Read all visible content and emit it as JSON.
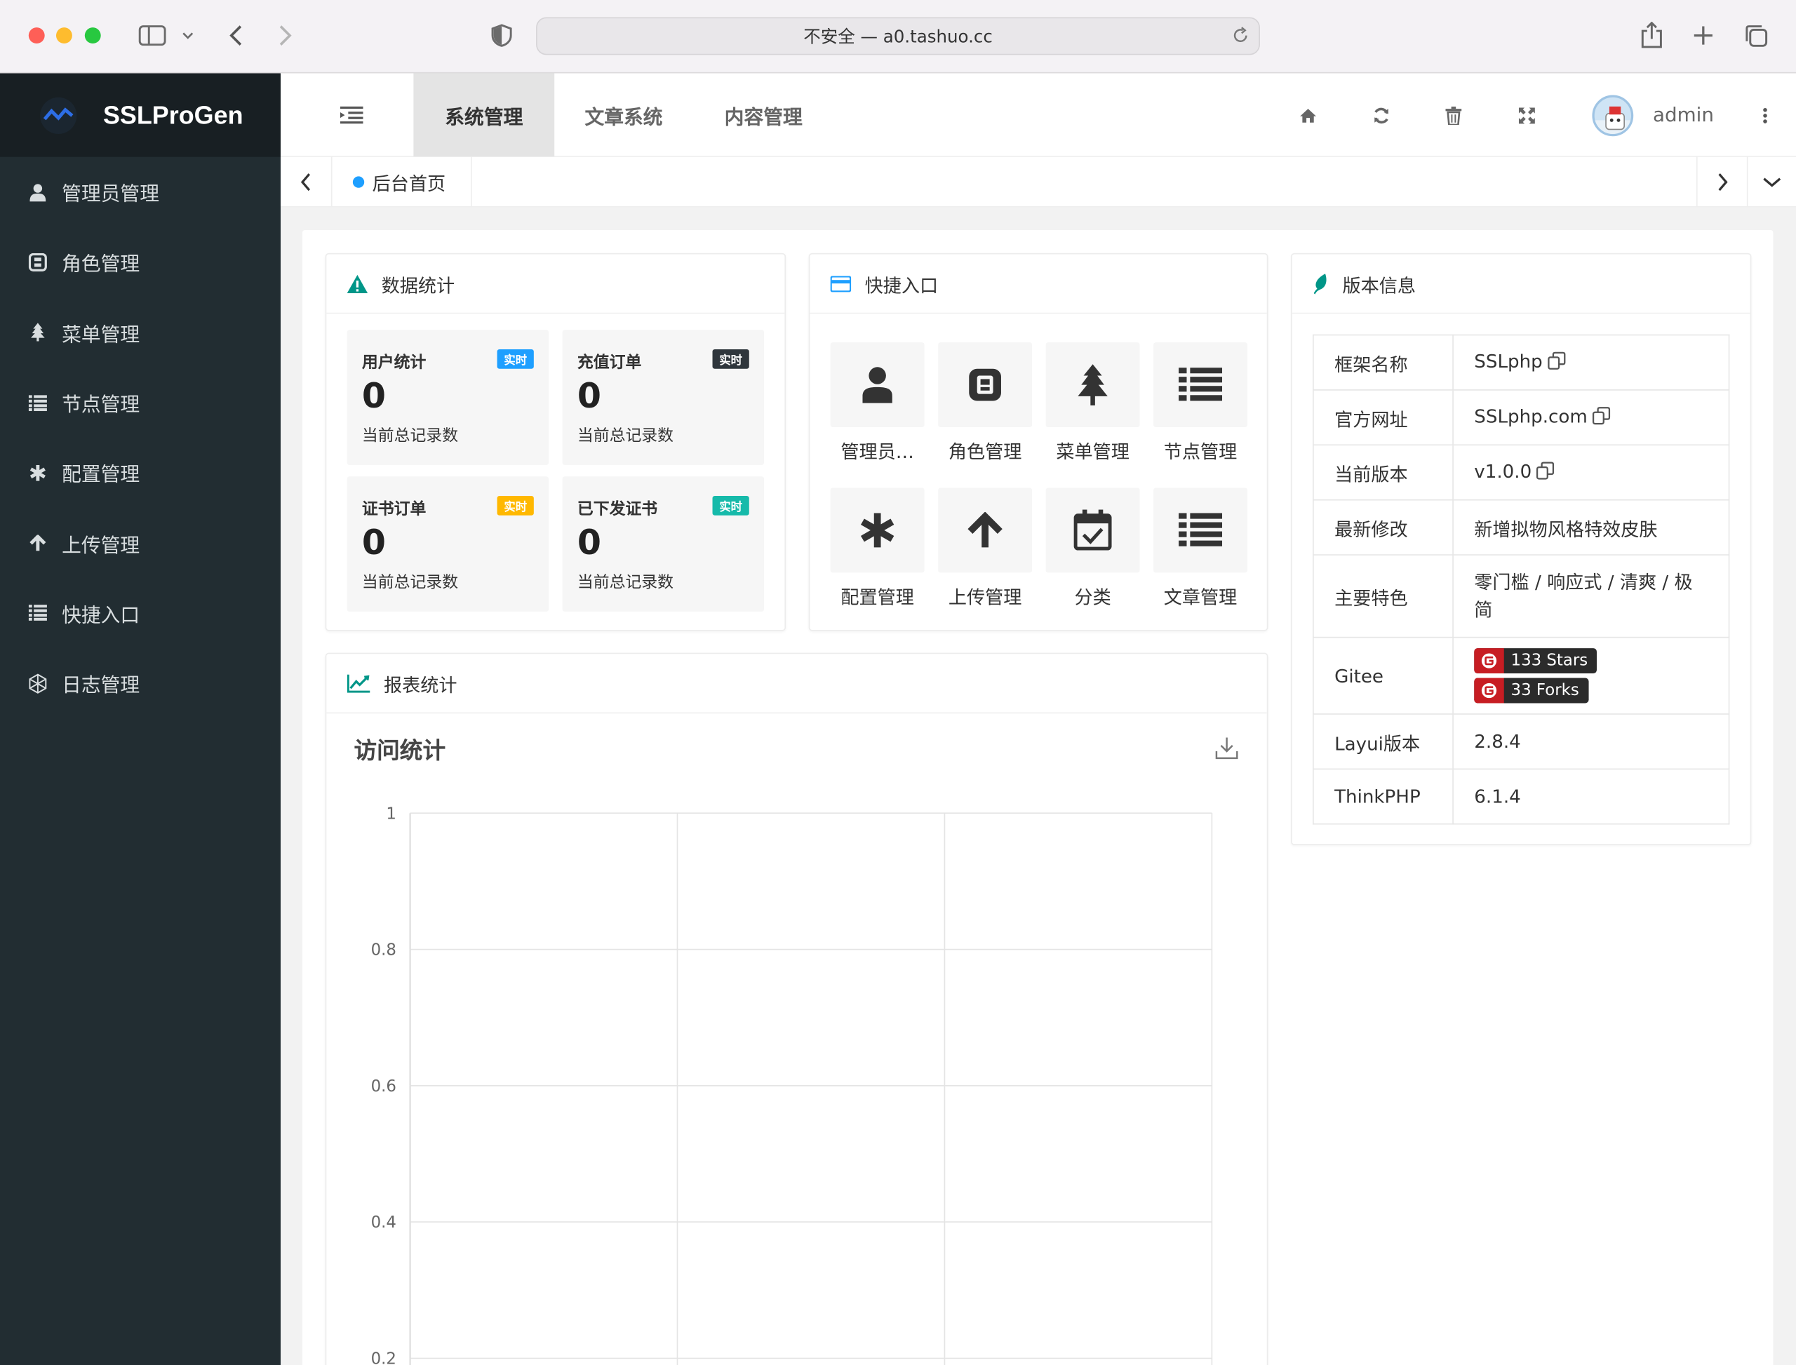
{
  "browser": {
    "url_text": "不安全 — a0.tashuo.cc"
  },
  "app": {
    "logo_text": "SSLProGen"
  },
  "sidebar": {
    "items": [
      {
        "label": "管理员管理",
        "icon": "user-icon"
      },
      {
        "label": "角色管理",
        "icon": "role-icon"
      },
      {
        "label": "菜单管理",
        "icon": "tree-icon"
      },
      {
        "label": "节点管理",
        "icon": "list-icon"
      },
      {
        "label": "配置管理",
        "icon": "asterisk-icon"
      },
      {
        "label": "上传管理",
        "icon": "arrow-up-icon"
      },
      {
        "label": "快捷入口",
        "icon": "list-icon"
      },
      {
        "label": "日志管理",
        "icon": "hexagon-icon"
      }
    ]
  },
  "header": {
    "tabs": [
      "系统管理",
      "文章系统",
      "内容管理"
    ],
    "user": "admin"
  },
  "tagbar": {
    "tag": "后台首页"
  },
  "stats": {
    "title": "数据统计",
    "items": [
      {
        "title": "用户统计",
        "badge": "实时",
        "value": "0",
        "desc": "当前总记录数",
        "color": "#1e9fff"
      },
      {
        "title": "充值订单",
        "badge": "实时",
        "value": "0",
        "desc": "当前总记录数",
        "color": "#2f363c"
      },
      {
        "title": "证书订单",
        "badge": "实时",
        "value": "0",
        "desc": "当前总记录数",
        "color": "#ffb800"
      },
      {
        "title": "已下发证书",
        "badge": "实时",
        "value": "0",
        "desc": "当前总记录数",
        "color": "#16baaa"
      }
    ]
  },
  "quick": {
    "title": "快捷入口",
    "items": [
      {
        "label": "管理员…",
        "icon": "user-icon"
      },
      {
        "label": "角色管理",
        "icon": "role-icon"
      },
      {
        "label": "菜单管理",
        "icon": "tree-icon"
      },
      {
        "label": "节点管理",
        "icon": "list-icon"
      },
      {
        "label": "配置管理",
        "icon": "asterisk-icon"
      },
      {
        "label": "上传管理",
        "icon": "arrow-up-icon"
      },
      {
        "label": "分类",
        "icon": "calendar-check-icon"
      },
      {
        "label": "文章管理",
        "icon": "list-icon"
      }
    ]
  },
  "version": {
    "title": "版本信息",
    "rows": [
      {
        "key": "框架名称",
        "value": "SSLphp"
      },
      {
        "key": "官方网址",
        "value": "SSLphp.com"
      },
      {
        "key": "当前版本",
        "value": "v1.0.0"
      },
      {
        "key": "最新修改",
        "value": "新增拟物风格特效皮肤"
      },
      {
        "key": "主要特色",
        "value": "零门槛 / 响应式 / 清爽 / 极简"
      },
      {
        "key": "Gitee",
        "stars": "133 Stars",
        "forks": "33 Forks"
      },
      {
        "key": "Layui版本",
        "value": "2.8.4"
      },
      {
        "key": "ThinkPHP",
        "value": "6.1.4"
      }
    ]
  },
  "report": {
    "title": "报表统计"
  },
  "chart_data": {
    "type": "line",
    "title": "访问统计",
    "categories": [
      "",
      "",
      ""
    ],
    "series": [],
    "y_ticks": [
      "1",
      "0.8",
      "0.6",
      "0.4",
      "0.2"
    ],
    "ylim": [
      0,
      1
    ],
    "grid": true
  }
}
